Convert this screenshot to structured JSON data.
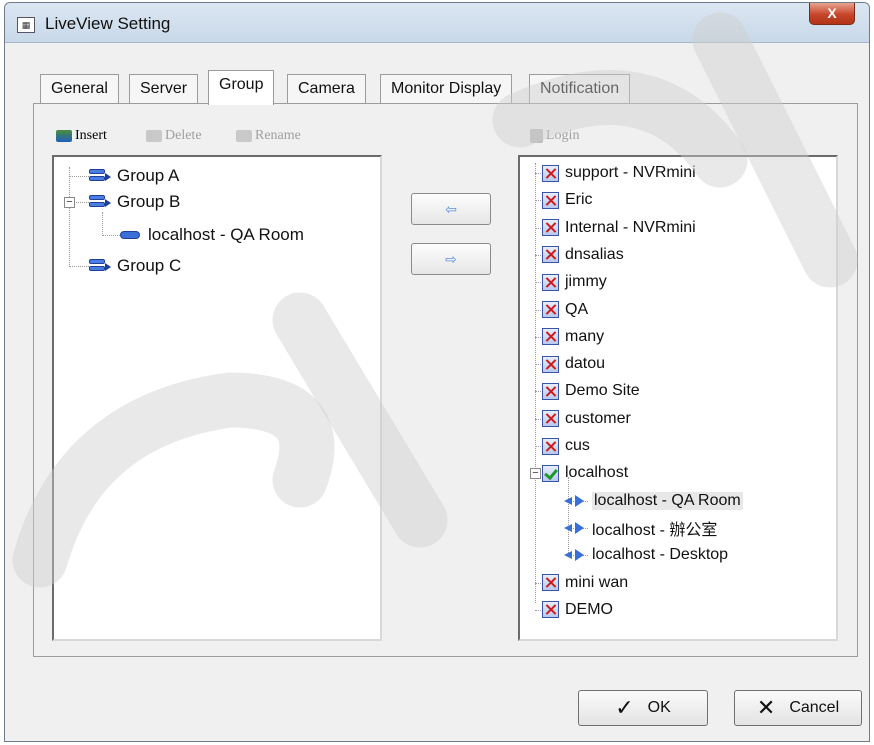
{
  "window": {
    "title": "LiveView Setting",
    "close_label": "X"
  },
  "tabs": [
    {
      "label": "General"
    },
    {
      "label": "Server"
    },
    {
      "label": "Group"
    },
    {
      "label": "Camera"
    },
    {
      "label": "Monitor Display"
    },
    {
      "label": "Notification"
    }
  ],
  "active_tab": "Group",
  "toolbar": {
    "insert_label": "Insert",
    "delete_label": "Delete",
    "rename_label": "Rename",
    "login_label": "Login"
  },
  "group_tree": {
    "items": [
      {
        "label": "Group A"
      },
      {
        "label": "Group B",
        "expanded": true
      },
      {
        "label": "localhost - QA Room"
      },
      {
        "label": "Group C"
      }
    ]
  },
  "server_tree": {
    "items": [
      {
        "label": "support - NVRmini",
        "status": "disconnected"
      },
      {
        "label": "Eric",
        "status": "disconnected"
      },
      {
        "label": "Internal - NVRmini",
        "status": "disconnected"
      },
      {
        "label": "dnsalias",
        "status": "disconnected"
      },
      {
        "label": "jimmy",
        "status": "disconnected"
      },
      {
        "label": "QA",
        "status": "disconnected"
      },
      {
        "label": "many",
        "status": "disconnected"
      },
      {
        "label": "datou",
        "status": "disconnected"
      },
      {
        "label": "Demo Site",
        "status": "disconnected"
      },
      {
        "label": "customer",
        "status": "disconnected"
      },
      {
        "label": "cus",
        "status": "disconnected"
      },
      {
        "label": "localhost",
        "status": "connected",
        "expanded": true
      },
      {
        "label": "localhost - QA Room",
        "selected": true
      },
      {
        "label": "localhost - 辦公室"
      },
      {
        "label": "localhost - Desktop"
      },
      {
        "label": "mini wan",
        "status": "disconnected"
      },
      {
        "label": "DEMO",
        "status": "disconnected"
      }
    ]
  },
  "buttons": {
    "ok_label": "OK",
    "cancel_label": "Cancel",
    "ok_symbol": "✓",
    "cancel_symbol": "✕"
  },
  "arrows": {
    "left_symbol": "⇦",
    "right_symbol": "⇨"
  },
  "colors": {
    "accent": "#3a6fd8",
    "disconnected": "#d01a1a",
    "connected": "#1e9a2a"
  }
}
